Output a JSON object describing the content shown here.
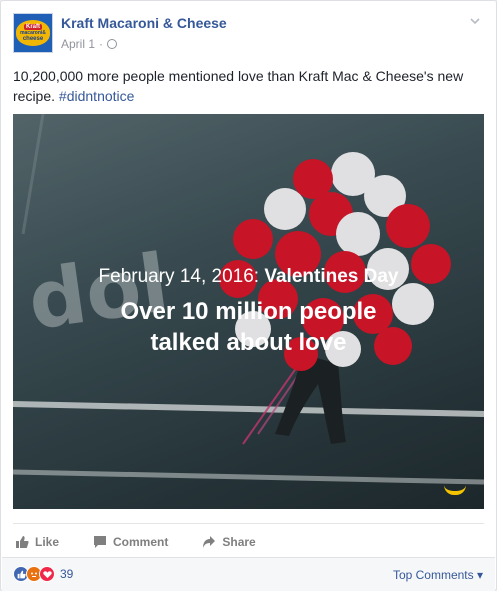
{
  "post": {
    "page_name": "Kraft Macaroni & Cheese",
    "date": "April 1",
    "separator": "·",
    "avatar_text": {
      "brand": "Kraft",
      "line1": "macaroni&",
      "line2": "cheese"
    },
    "text_main": "10,200,000 more people mentioned love than Kraft Mac & Cheese's new recipe.",
    "hashtag": "#didntnotice",
    "image": {
      "date_text": "February 14, 2016:",
      "event": "Valentines Day",
      "headline_line1": "Over 10 million people",
      "headline_line2": "talked about love"
    }
  },
  "actions": {
    "like": "Like",
    "comment": "Comment",
    "share": "Share"
  },
  "footer": {
    "reaction_count": "39",
    "top_comments": "Top Comments ▾"
  },
  "colors": {
    "link": "#365899",
    "muted": "#90949c",
    "balloon_red": "#d8162b",
    "balloon_white": "#f4f4f6",
    "accent_yellow": "#f5c400"
  }
}
